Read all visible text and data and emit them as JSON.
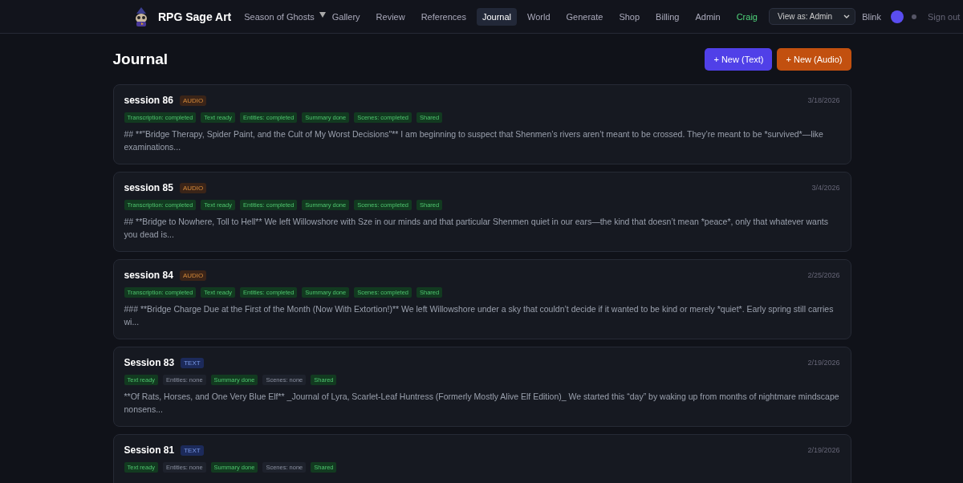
{
  "nav": {
    "brand": "RPG Sage Art",
    "season": "Season of Ghosts",
    "items": [
      {
        "label": "Gallery",
        "selected": false
      },
      {
        "label": "Review",
        "selected": false
      },
      {
        "label": "References",
        "selected": false
      },
      {
        "label": "Journal",
        "selected": true
      },
      {
        "label": "World",
        "selected": false
      },
      {
        "label": "Generate",
        "selected": false
      },
      {
        "label": "Shop",
        "selected": false
      },
      {
        "label": "Billing",
        "selected": false
      },
      {
        "label": "Admin",
        "selected": false
      }
    ],
    "user_link": "Craig",
    "view_as": "View as: Admin",
    "account": "Blink",
    "sign_out": "Sign out"
  },
  "page": {
    "title": "Journal",
    "buttons": [
      {
        "label": "+ New (Text)",
        "kind": "text"
      },
      {
        "label": "+ New (Audio)",
        "kind": "audio"
      }
    ]
  },
  "entries": [
    {
      "title": "session 86",
      "kind": "audio",
      "type_label": "AUDIO",
      "date": "3/18/2026",
      "tags": [
        {
          "label": "Transcription: completed",
          "done": true
        },
        {
          "label": "Text ready",
          "done": true
        },
        {
          "label": "Entities: completed",
          "done": true
        },
        {
          "label": "Summary done",
          "done": true
        },
        {
          "label": "Scenes: completed",
          "done": true
        },
        {
          "label": "Shared",
          "done": true
        }
      ],
      "summary": "## **\"Bridge Therapy, Spider Paint, and the Cult of My Worst Decisions\"** I am beginning to suspect that Shenmen’s rivers aren’t meant to be crossed. They’re meant to be *survived*—like examinations..."
    },
    {
      "title": "session 85",
      "kind": "audio",
      "type_label": "AUDIO",
      "date": "3/4/2026",
      "tags": [
        {
          "label": "Transcription: completed",
          "done": true
        },
        {
          "label": "Text ready",
          "done": true
        },
        {
          "label": "Entities: completed",
          "done": true
        },
        {
          "label": "Summary done",
          "done": true
        },
        {
          "label": "Scenes: completed",
          "done": true
        },
        {
          "label": "Shared",
          "done": true
        }
      ],
      "summary": "## **Bridge to Nowhere, Toll to Hell** We left Willowshore with Sze in our minds and that particular Shenmen quiet in our ears—the kind that doesn’t mean *peace*, only that whatever wants you dead is..."
    },
    {
      "title": "session 84",
      "kind": "audio",
      "type_label": "AUDIO",
      "date": "2/25/2026",
      "tags": [
        {
          "label": "Transcription: completed",
          "done": true
        },
        {
          "label": "Text ready",
          "done": true
        },
        {
          "label": "Entities: completed",
          "done": true
        },
        {
          "label": "Summary done",
          "done": true
        },
        {
          "label": "Scenes: completed",
          "done": true
        },
        {
          "label": "Shared",
          "done": true
        }
      ],
      "summary": "### **Bridge Charge Due at the First of the Month (Now With Extortion!)** We left Willowshore under a sky that couldn’t decide if it wanted to be kind or merely *quiet*. Early spring still carries wi..."
    },
    {
      "title": "Session 83",
      "kind": "text",
      "type_label": "TEXT",
      "date": "2/19/2026",
      "tags": [
        {
          "label": "Text ready",
          "done": true
        },
        {
          "label": "Entities: none",
          "done": false
        },
        {
          "label": "Summary done",
          "done": true
        },
        {
          "label": "Scenes: none",
          "done": false
        },
        {
          "label": "Shared",
          "done": true
        }
      ],
      "summary": "**Of Rats, Horses, and One Very Blue Elf** _Journal of Lyra, Scarlet-Leaf Huntress (Formerly Mostly Alive Elf Edition)_ We started this “day” by waking up from months of nightmare mindscape nonsens..."
    },
    {
      "title": "Session 81",
      "kind": "text",
      "type_label": "TEXT",
      "date": "2/19/2026",
      "tags": [
        {
          "label": "Text ready",
          "done": true
        },
        {
          "label": "Entities: none",
          "done": false
        },
        {
          "label": "Summary done",
          "done": true
        },
        {
          "label": "Scenes: none",
          "done": false
        },
        {
          "label": "Shared",
          "done": true
        }
      ]
    }
  ]
}
